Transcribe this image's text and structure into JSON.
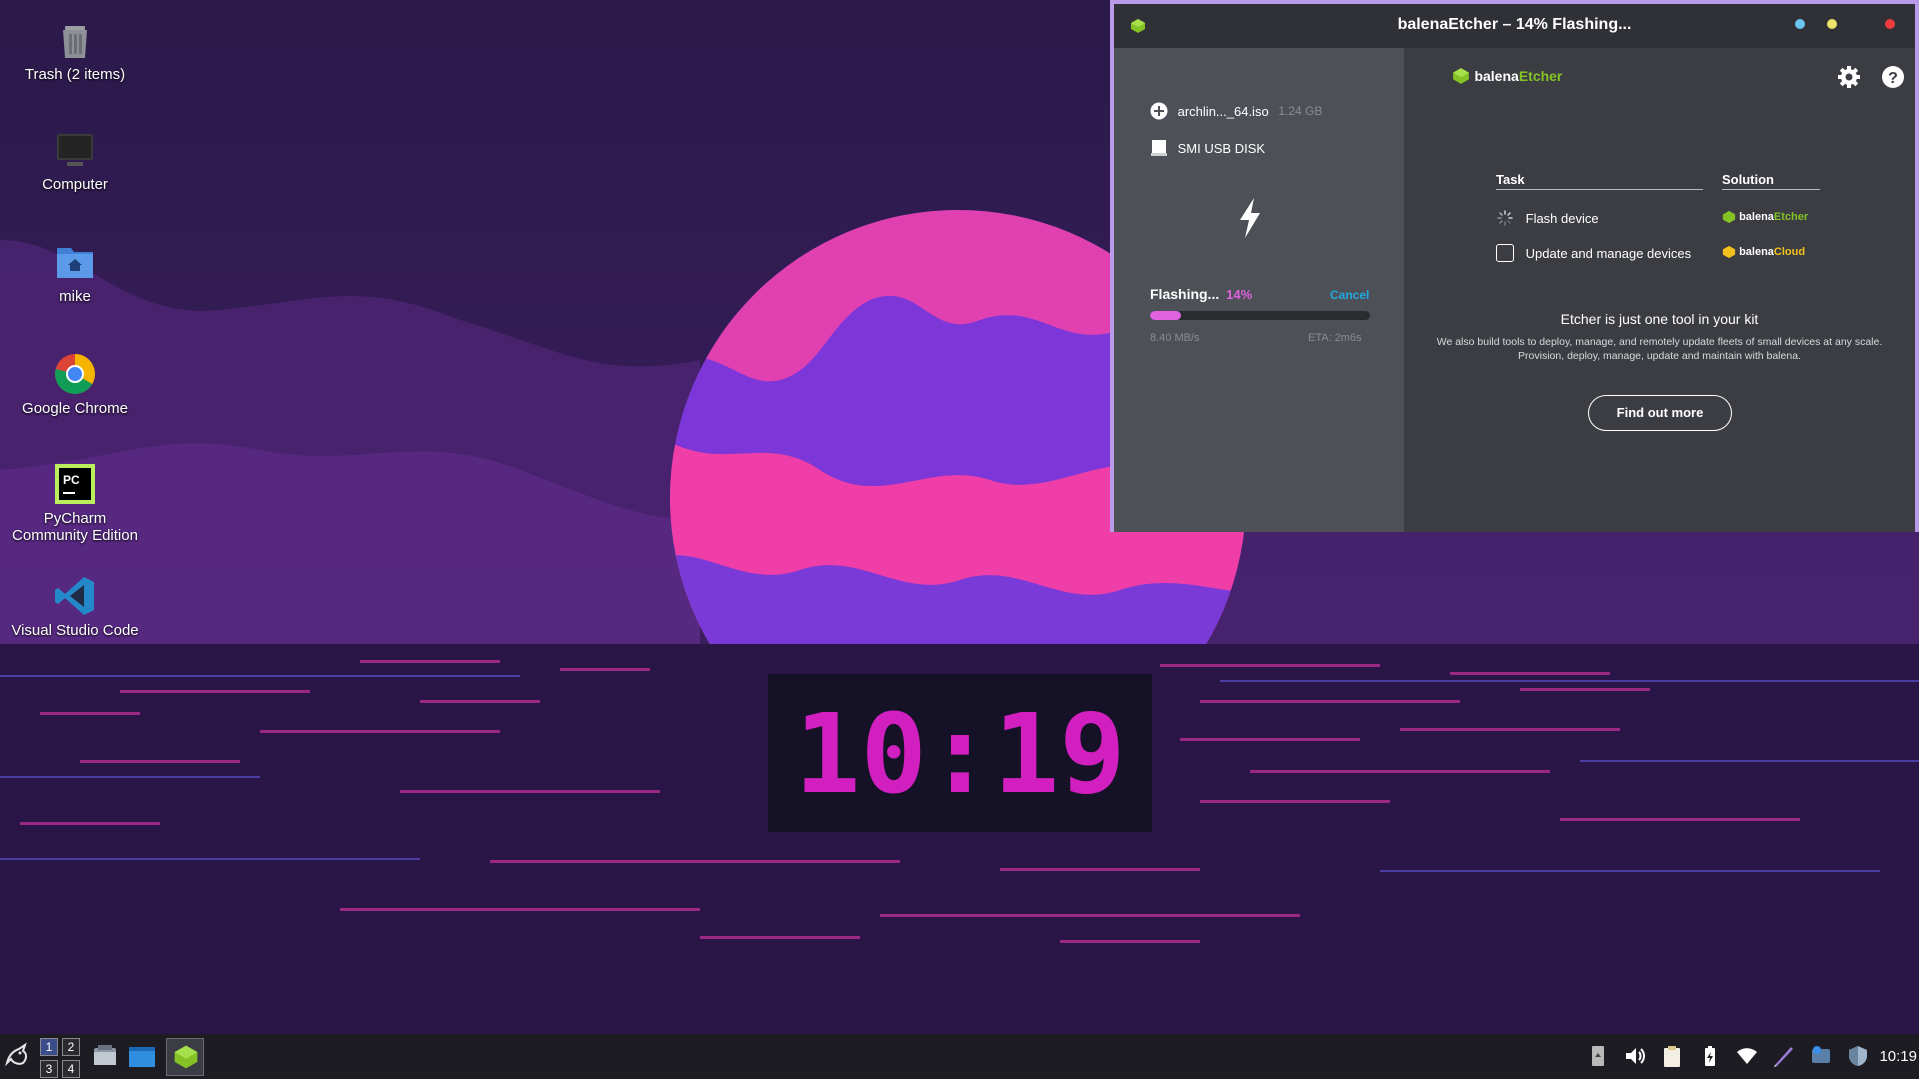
{
  "desktop": {
    "icons": [
      {
        "label": "Trash (2 items)"
      },
      {
        "label": "Computer"
      },
      {
        "label": "mike"
      },
      {
        "label": "Google Chrome"
      },
      {
        "label": "PyCharm Community Edition"
      },
      {
        "label": "Visual Studio Code"
      }
    ]
  },
  "clock": {
    "time": "10:19"
  },
  "etcher": {
    "window_title": "balenaEtcher – 14% Flashing...",
    "brand": {
      "part1": "balena",
      "part2": "Etcher"
    },
    "image": {
      "name": "archlin..._64.iso",
      "size": "1.24 GB"
    },
    "drive": {
      "name": "SMI USB DISK"
    },
    "progress": {
      "label": "Flashing...",
      "percent_text": "14%",
      "percent": 14,
      "cancel": "Cancel",
      "speed": "8.40 MB/s",
      "eta": "ETA: 2m6s"
    },
    "table": {
      "task_header": "Task",
      "solution_header": "Solution",
      "rows": [
        {
          "task": "Flash device",
          "solution_part1": "balena",
          "solution_part2": "Etcher"
        },
        {
          "task": "Update and manage devices",
          "solution_part1": "balena",
          "solution_part2": "Cloud"
        }
      ]
    },
    "promo": {
      "title": "Etcher is just one tool in your kit",
      "line1": "We also build tools to deploy, manage, and remotely update fleets of small devices at any scale.",
      "line2": "Provision, deploy, manage, update and maintain with balena.",
      "button": "Find out more"
    },
    "colors": {
      "accent_green": "#85c225",
      "progress_pink": "#e062e0",
      "cancel_blue": "#22a8e0",
      "cloud_yellow": "#f3c11b"
    }
  },
  "taskbar": {
    "workspaces": [
      "1",
      "2",
      "3",
      "4"
    ],
    "time": "10:19"
  }
}
